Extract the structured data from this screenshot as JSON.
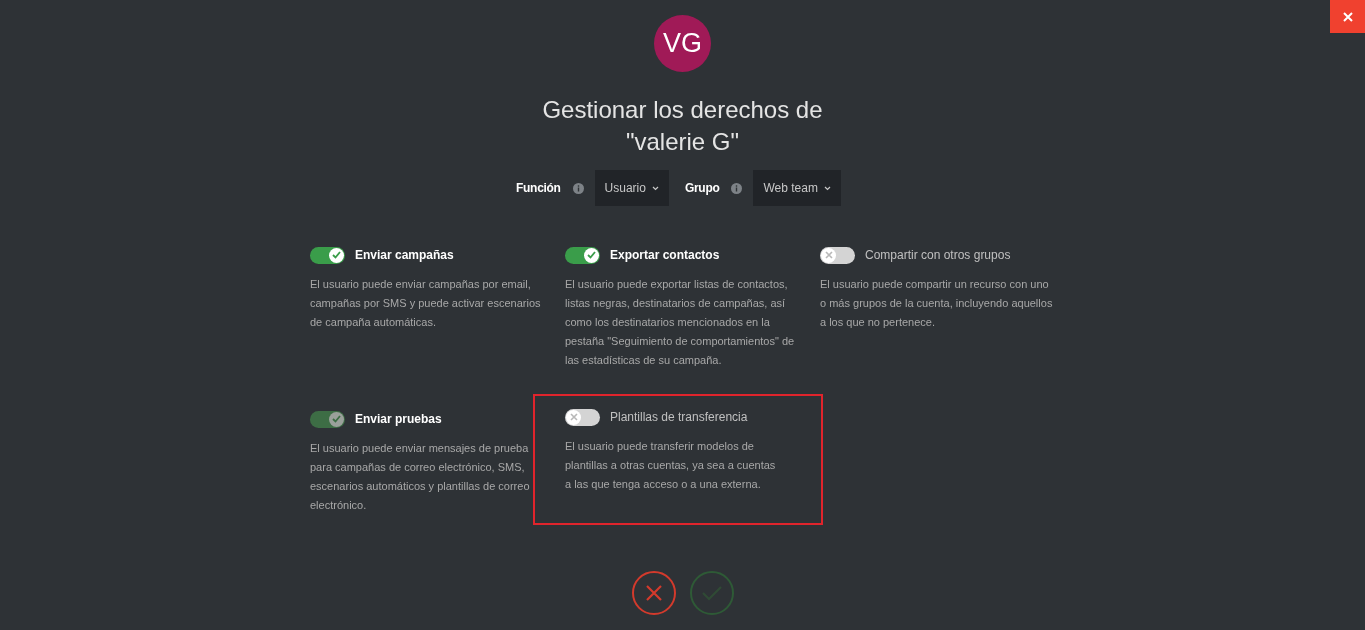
{
  "avatar": {
    "initials": "VG"
  },
  "title": "Gestionar los derechos de \"valerie G\"",
  "selectors": [
    {
      "label": "Función",
      "value": "Usuario"
    },
    {
      "label": "Grupo",
      "value": "Web team"
    }
  ],
  "permissions": [
    {
      "name": "Enviar campañas",
      "on": true,
      "disabled": false,
      "highlighted": false,
      "description": "El usuario puede enviar campañas por email, campañas por SMS y puede activar escenarios de campaña automáticas."
    },
    {
      "name": "Exportar contactos",
      "on": true,
      "disabled": false,
      "highlighted": false,
      "description": "El usuario puede exportar listas de contactos, listas negras, destinatarios de campañas, así como los destinatarios mencionados en la pestaña \"Seguimiento de comportamientos\" de las estadísticas de su campaña."
    },
    {
      "name": "Compartir con otros grupos",
      "on": false,
      "disabled": false,
      "highlighted": false,
      "description": "El usuario puede compartir un recurso con uno o más grupos de la cuenta, incluyendo aquellos a los que no pertenece."
    },
    {
      "name": "Enviar pruebas",
      "on": true,
      "disabled": true,
      "highlighted": false,
      "description": "El usuario puede enviar mensajes de prueba para campañas de correo electrónico, SMS, escenarios automáticos y plantillas de correo electrónico."
    },
    {
      "name": "Plantillas de transferencia",
      "on": false,
      "disabled": false,
      "highlighted": true,
      "description": "El usuario puede transferir modelos de plantillas a otras cuentas, ya sea a cuentas a las que tenga acceso o a una externa."
    }
  ],
  "actions": [
    {
      "kind": "cancel",
      "disabled": false
    },
    {
      "kind": "confirm",
      "disabled": true
    }
  ]
}
